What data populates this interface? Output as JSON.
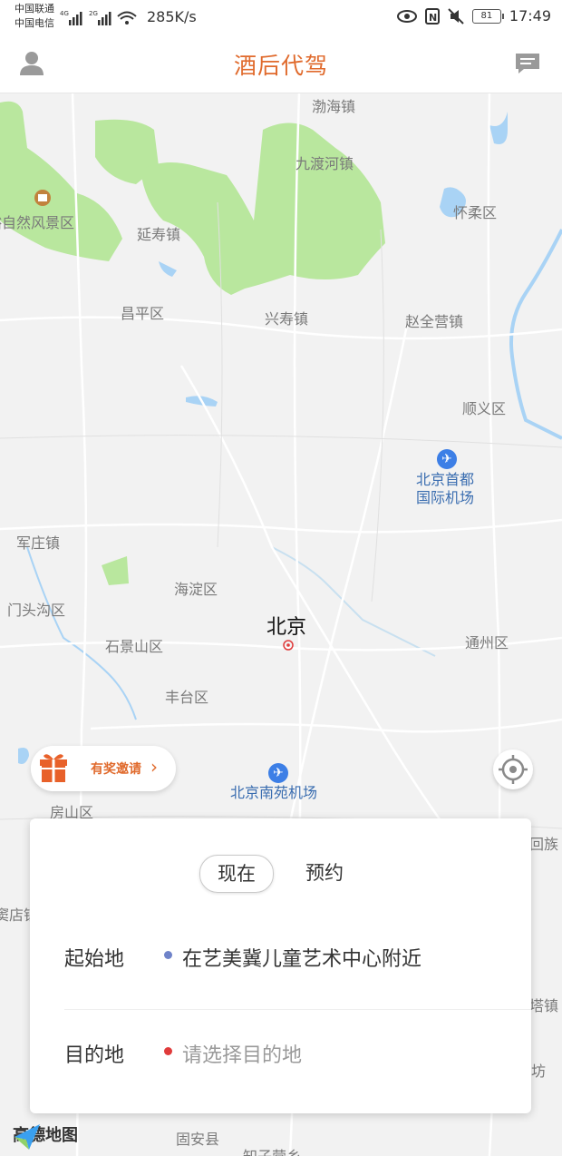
{
  "status_bar": {
    "carrier_1": "中国联通",
    "carrier_2": "中国电信",
    "signal_1": "4G",
    "signal_2": "2G",
    "net_speed": "285K/s",
    "battery": "81",
    "time": "17:49"
  },
  "header": {
    "title": "酒后代驾",
    "profile_icon": "person-icon",
    "message_icon": "chat-icon"
  },
  "map": {
    "places": [
      {
        "name": "渤海镇"
      },
      {
        "name": "九渡河镇"
      },
      {
        "name": "怀柔区"
      },
      {
        "name": "峪自然风景区"
      },
      {
        "name": "延寿镇"
      },
      {
        "name": "昌平区"
      },
      {
        "name": "兴寿镇"
      },
      {
        "name": "赵全营镇"
      },
      {
        "name": "顺义区"
      },
      {
        "name": "军庄镇"
      },
      {
        "name": "海淀区"
      },
      {
        "name": "门头沟区"
      },
      {
        "name": "石景山区"
      },
      {
        "name": "通州区"
      },
      {
        "name": "丰台区"
      },
      {
        "name": "房山区"
      },
      {
        "name": "回族"
      },
      {
        "name": "窦店镇"
      },
      {
        "name": "塔镇"
      },
      {
        "name": "坊"
      },
      {
        "name": "固安县"
      },
      {
        "name": "知子营乡"
      }
    ],
    "city": "北京",
    "airports": [
      {
        "name_line1": "北京首都",
        "name_line2": "国际机场"
      },
      {
        "name_line1": "北京南苑机场",
        "name_line2": ""
      }
    ],
    "provider_logo": "高德地图",
    "colors": {
      "park": "#b9e79e",
      "water": "#a9d3f5",
      "road": "#ffffff",
      "accent": "#e06a2c"
    }
  },
  "invite": {
    "label": "有奖邀请",
    "gift_icon": "gift-icon",
    "arrow_icon": "chevron-right-icon"
  },
  "locate_button": {
    "icon": "crosshair-icon"
  },
  "booking": {
    "tabs": [
      {
        "label": "现在",
        "active": true
      },
      {
        "label": "预约",
        "active": false
      }
    ],
    "origin_label": "起始地",
    "origin_value": "在艺美冀儿童艺术中心附近",
    "origin_dot_color": "#6f83c9",
    "destination_label": "目的地",
    "destination_placeholder": "请选择目的地",
    "destination_dot_color": "#e03b3b"
  }
}
